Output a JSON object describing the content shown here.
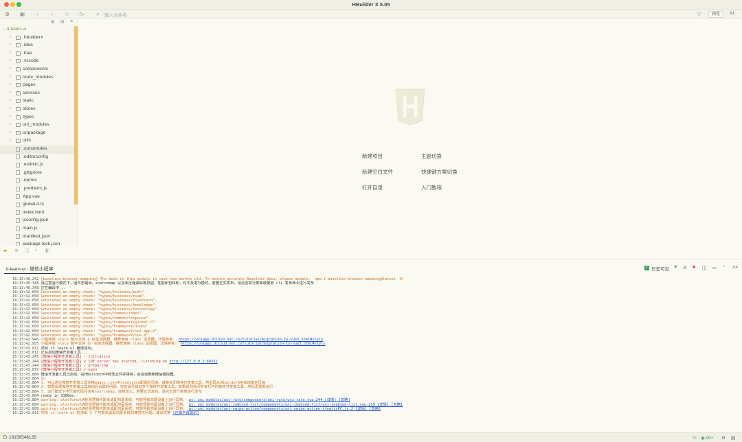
{
  "window": {
    "title": "HBuilder X 5.05"
  },
  "toolbar": {
    "search_placeholder": "输入文件名",
    "preview_label": "预览",
    "ai_label": "AI"
  },
  "sidebar": {
    "items": [
      {
        "label": "it-learn-ui",
        "type": "root"
      },
      {
        "label": ".hbuilderx",
        "type": "folder"
      },
      {
        "label": ".idea",
        "type": "folder"
      },
      {
        "label": ".trae",
        "type": "folder"
      },
      {
        "label": ".vscode",
        "type": "folder"
      },
      {
        "label": "components",
        "type": "folder"
      },
      {
        "label": "node_modules",
        "type": "folder"
      },
      {
        "label": "pages",
        "type": "folder"
      },
      {
        "label": "services",
        "type": "folder"
      },
      {
        "label": "static",
        "type": "folder"
      },
      {
        "label": "stores",
        "type": "folder"
      },
      {
        "label": "types",
        "type": "folder"
      },
      {
        "label": "uni_modules",
        "type": "folder"
      },
      {
        "label": "unpackage",
        "type": "folder"
      },
      {
        "label": "utils",
        "type": "folder"
      },
      {
        "label": ".cursorrules",
        "type": "file",
        "selected": true
      },
      {
        "label": ".editorconfig",
        "type": "file"
      },
      {
        "label": ".eslintrc.js",
        "type": "file"
      },
      {
        "label": ".gitignore",
        "type": "file"
      },
      {
        "label": ".npmrc",
        "type": "file"
      },
      {
        "label": ".prettierrc.js",
        "type": "file"
      },
      {
        "label": "App.vue",
        "type": "file"
      },
      {
        "label": "global.d.ts",
        "type": "file"
      },
      {
        "label": "index.html",
        "type": "file"
      },
      {
        "label": "jsconfig.json",
        "type": "file"
      },
      {
        "label": "main.js",
        "type": "file"
      },
      {
        "label": "manifest.json",
        "type": "file"
      },
      {
        "label": "package-lock.json",
        "type": "file"
      }
    ]
  },
  "welcome": {
    "new_project": "新建项目",
    "theme_switch": "主题切换",
    "new_blank_file": "新建空白文件",
    "keymap_switch": "快捷键方案切换",
    "open_dir": "打开目录",
    "intro_tutorial": "入门教程"
  },
  "panel": {
    "tab_label": "it-learn-ui - 微信小程序",
    "log_visible_label": "日志可见",
    "font_scale": "X4"
  },
  "console": {
    "lines": [
      {
        "ts": "16:13:40.242",
        "text": "[baseline-browser-mapping] The data in this module is over two months old.  To ensure accurate Baseline data, please update: `npm i baseline-browser-mapping@latest -D`",
        "style": "orange"
      },
      {
        "ts": "16:13:40.348",
        "text": "请注意运行模式下，因日志输出、sourcemap 以及未压缩源码等原因，性能和包体积，均不及发行模式。若要正式发布，请点击发行菜单或使用 cli 发布命令进行发布",
        "style": "normal"
      },
      {
        "ts": "16:13:40.348",
        "text": "正在编译中...",
        "style": "normal"
      },
      {
        "ts": "16:13:42.650",
        "text": "Generated an empty chunk: \"types/business/auth\".",
        "style": "orange"
      },
      {
        "ts": "16:13:42.650",
        "text": "Generated an empty chunk: \"types/business/exam\".",
        "style": "orange"
      },
      {
        "ts": "16:13:42.650",
        "text": "Generated an empty chunk: \"types/business/flashcard\".",
        "style": "orange"
      },
      {
        "ts": "16:13:42.650",
        "text": "Generated an empty chunk: \"types/business/knowledge\".",
        "style": "orange"
      },
      {
        "ts": "16:13:42.650",
        "text": "Generated an empty chunk: \"types/business/technology\".",
        "style": "orange"
      },
      {
        "ts": "16:13:42.650",
        "text": "Generated an empty chunk: \"types/common/index\".",
        "style": "orange"
      },
      {
        "ts": "16:13:42.650",
        "text": "Generated an empty chunk: \"types/common/response\".",
        "style": "orange"
      },
      {
        "ts": "16:13:42.650",
        "text": "Generated an empty chunk: \"types/framework/global.d\".",
        "style": "orange"
      },
      {
        "ts": "16:13:42.650",
        "text": "Generated an empty chunk: \"types/framework/index\".",
        "style": "orange"
      },
      {
        "ts": "16:13:42.650",
        "text": "Generated an empty chunk: \"types/framework/uni-app.d\".",
        "style": "orange"
      },
      {
        "ts": "16:13:42.650",
        "text": "Generated an empty chunk: \"types/framework/vue.d\".",
        "style": "orange"
      },
      {
        "ts": "16:13:42.946",
        "text": "小程序端 style 暂不支持 p 标签选择器，推荐使用 class 选择器，详情参考：",
        "link": "https://uniapp.dcloud.net.cn/tutorial/migration-to-vue3.html#style",
        "style": "orange"
      },
      {
        "ts": "16:13:42.955",
        "text": "小程序端 style 暂不支持 br 标签选择器，推荐使用 class 选择器，详情参考：",
        "link": "https://uniapp.dcloud.net.cn/tutorial/migration-to-vue3.html#style",
        "style": "orange"
      },
      {
        "ts": "16:13:43.011",
        "text": "项目 it-learn-ui 编译成功。",
        "style": "normal"
      },
      {
        "ts": "16:13:43.011",
        "text": "正在启动微信开发者工具...",
        "style": "normal"
      },
      {
        "ts": "16:13:43.241",
        "text": "[微信小程序开发者工具] - initialize",
        "style": "red"
      },
      {
        "ts": "16:13:43.244",
        "text": "[微信小程序开发者工具] ✔ IDE server has started, listening on",
        "link": "http://127.0.0.1:60331",
        "style": "red"
      },
      {
        "ts": "16:13:43.244",
        "text": "[微信小程序开发者工具] - preparing",
        "style": "red"
      },
      {
        "ts": "16:13:43.879",
        "text": "[微信小程序开发者工具] ✔ open",
        "style": "red"
      },
      {
        "ts": "16:13:43.884",
        "text": "微信开发者工具已启动，在HBuilderX中修改文件并保存，会自动刷新微信模拟器。",
        "style": "normal"
      },
      {
        "ts": "16:13:43.884",
        "text": "注：",
        "style": "orange"
      },
      {
        "ts": "16:13:43.884",
        "text": "1. 可以通过微信开发者工具切换pages.json中condition配置的页面，或者关闭微信开发者工具，然后再从HBuilderX中启动指定页面",
        "style": "orange"
      },
      {
        "ts": "16:13:43.884",
        "text": "2. 如果出现微信开发者工具启动后白屏的问题，检查是否启动多个微信开发者工具，如果是则关闭所有打开的微信开发者工具，然后再重新运行",
        "style": "orange"
      },
      {
        "ts": "16:13:43.884",
        "text": "3. 运行模式下不压缩代码且含有sourcemap，体积较大；若要正式发布，请点击发行菜单进行发布",
        "style": "orange"
      },
      {
        "ts": "16:13:43.884",
        "text": "ready in 3386ms.",
        "style": "normal"
      },
      {
        "ts": "16:13:43.884",
        "text": "warning: platform/UA检测逻辑可能未适配鸿蒙系统，可能导致鸿蒙设备上运行异常，",
        "link": "at: uni_modules/uni-rate/components/uni-rate/uni-rate.vue:244 [详情] [忽略]",
        "style": "orange"
      },
      {
        "ts": "16:13:43.884",
        "text": "warning: platform/UA检测逻辑可能未适配鸿蒙系统，可能导致鸿蒙设备上运行异常，",
        "link": "at: uni_modules/uni-indexed-list/components/uni-indexed-list/uni-indexed-list.vue:239 [详情] [忽略]",
        "style": "orange"
      },
      {
        "ts": "16:13:43.889",
        "text": "warning: platform/UA检测逻辑可能未适配鸿蒙系统，可能导致鸿蒙设备上运行异常，",
        "link": "at: uni_modules/uni-swipe-action/components/uni-swipe-action-item/isPC.js:2 [详情] [忽略]",
        "style": "orange"
      },
      {
        "ts": "16:13:43.911",
        "text": "项目 it-learn-ui 检测出 3 个可能未适配鸿蒙系统的兼容性问题，建议修复",
        "link": "[还需不再提示]",
        "style": "orange"
      }
    ]
  },
  "status": {
    "user": "18156548135",
    "zoom": "90+"
  }
}
